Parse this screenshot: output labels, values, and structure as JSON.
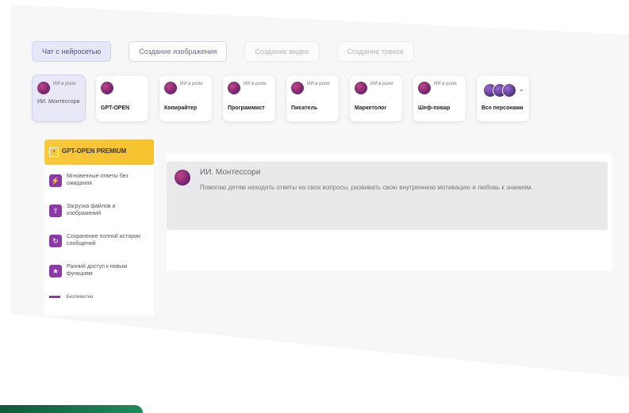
{
  "tabs": [
    {
      "label": "Чат с нейросетью",
      "state": "active"
    },
    {
      "label": "Создание изображения",
      "state": "default"
    },
    {
      "label": "Создание видео",
      "state": "muted"
    },
    {
      "label": "Создание треков",
      "state": "muted"
    }
  ],
  "personas": [
    {
      "name": "ИИ. Монтессори",
      "sub": "ИИ в роли",
      "selected": true
    },
    {
      "name": "GPT-OPEN",
      "sub": "",
      "selected": false
    },
    {
      "name": "Копирайтер",
      "sub": "ИИ в роли",
      "selected": false
    },
    {
      "name": "Программист",
      "sub": "ИИ в роли",
      "selected": false
    },
    {
      "name": "Писатель",
      "sub": "ИИ в роли",
      "selected": false
    },
    {
      "name": "Маркетолог",
      "sub": "ИИ в роли",
      "selected": false
    },
    {
      "name": "Шеф-повар",
      "sub": "ИИ в роли",
      "selected": false
    }
  ],
  "all_personas_label": "Все персонажи",
  "premium": {
    "title": "GPT-OPEN PREMIUM",
    "features": [
      "Мгновенные ответы без ожидания",
      "Загрузка файлов и изображений",
      "Сохранение полной истории сообщений",
      "Ранний доступ к новым функциям"
    ],
    "extra": "Безлимитно"
  },
  "chat": {
    "author": "ИИ. Монтессори",
    "message": "Помогаю детям находить ответы на свои вопросы, развивать свою внутреннюю мотивацию и любовь к знаниям."
  }
}
